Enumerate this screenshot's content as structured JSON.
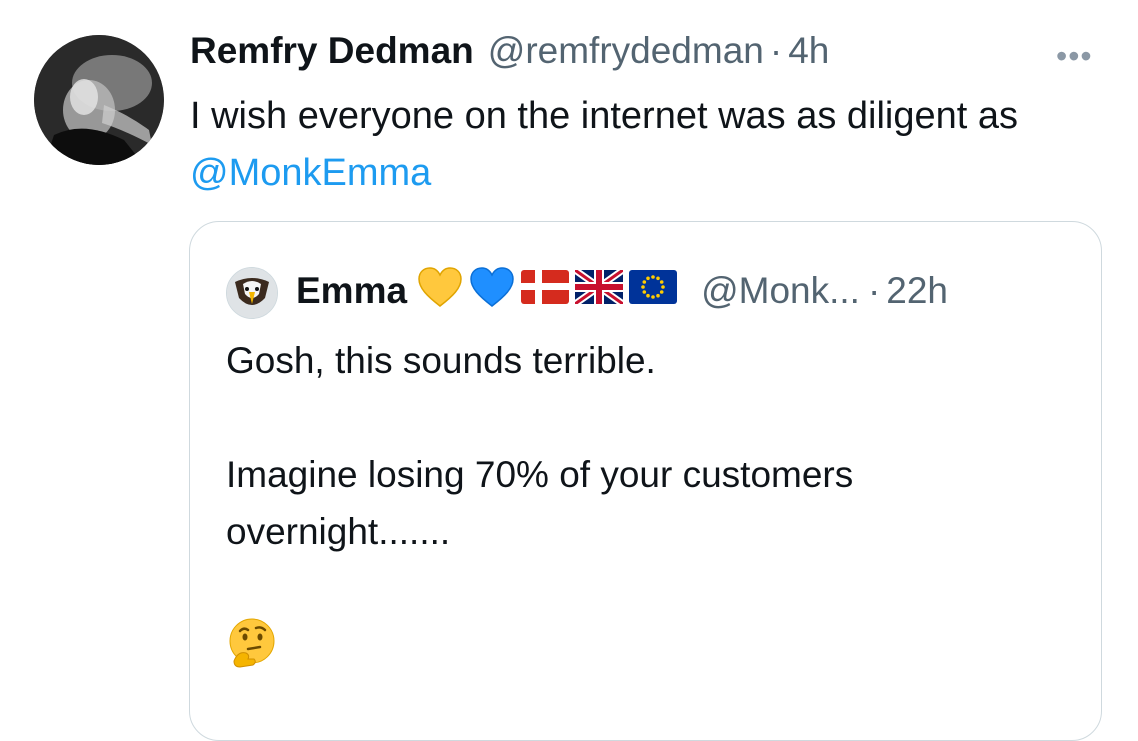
{
  "tweet": {
    "author_name": "Remfry Dedman",
    "author_handle": "@remfrydedman",
    "separator": "·",
    "time": "4h",
    "more_label": "•••",
    "text_prefix": "I wish everyone on the internet was as diligent as ",
    "mention": "@MonkEmma"
  },
  "quote": {
    "author_name": "Emma",
    "badges": [
      "yellow-heart-icon",
      "blue-heart-icon",
      "denmark-flag-icon",
      "uk-flag-icon",
      "eu-flag-icon"
    ],
    "author_handle": "@Monk...",
    "separator": "·",
    "time": "22h",
    "lines": [
      "Gosh, this sounds terrible.",
      "",
      "Imagine losing 70% of your customers overnight.......",
      ""
    ],
    "emoji_name": "thinking-face-icon"
  },
  "colors": {
    "link": "#1d9bf0",
    "muted": "#536471",
    "border": "#cfd9de"
  }
}
